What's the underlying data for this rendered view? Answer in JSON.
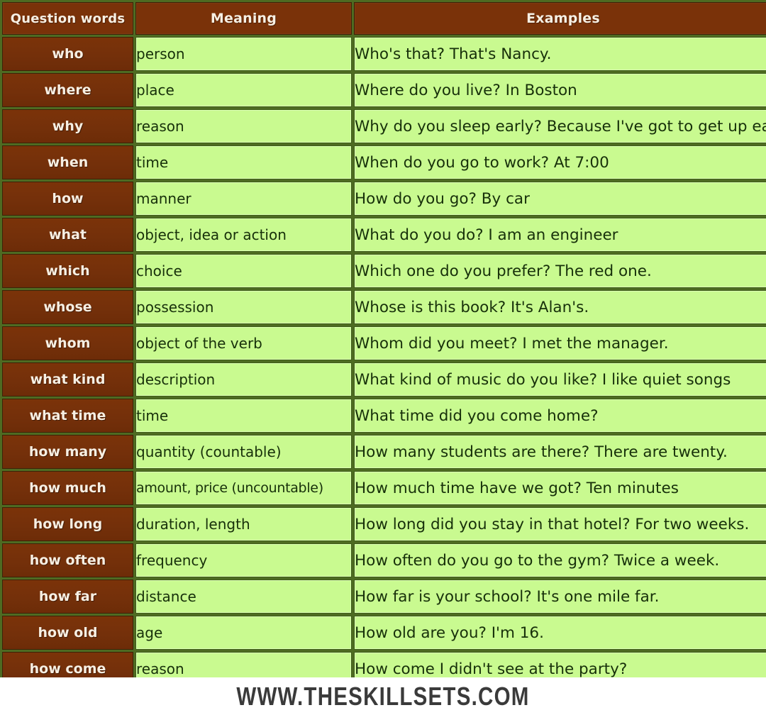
{
  "table": {
    "columns": [
      "Question words",
      "Meaning",
      "Examples"
    ],
    "rows": [
      {
        "word": "who",
        "meaning": "person",
        "example": "Who's that? That's Nancy."
      },
      {
        "word": "where",
        "meaning": "place",
        "example": "Where do you live? In Boston"
      },
      {
        "word": "why",
        "meaning": "reason",
        "example": "Why do you sleep early? Because I've got to get up early"
      },
      {
        "word": "when",
        "meaning": "time",
        "example": "When do you go to work? At 7:00"
      },
      {
        "word": "how",
        "meaning": "manner",
        "example": "How do you go? By car"
      },
      {
        "word": "what",
        "meaning": "object, idea or action",
        "example": "What do you do? I am an engineer"
      },
      {
        "word": "which",
        "meaning": "choice",
        "example": "Which one do you prefer? The red one."
      },
      {
        "word": "whose",
        "meaning": "possession",
        "example": "Whose is this book? It's Alan's."
      },
      {
        "word": "whom",
        "meaning": "object of the verb",
        "example": "Whom did you meet? I met the manager."
      },
      {
        "word": "what kind",
        "meaning": "description",
        "example": "What kind of music do you like? I like quiet songs"
      },
      {
        "word": "what time",
        "meaning": "time",
        "example": "What time did you come home?"
      },
      {
        "word": "how many",
        "meaning": "quantity (countable)",
        "example": "How many students are there? There are twenty."
      },
      {
        "word": "how much",
        "meaning": "amount, price (uncountable)",
        "example": "How much time have we got? Ten minutes"
      },
      {
        "word": "how long",
        "meaning": "duration, length",
        "example": "How long did you stay in that hotel? For two weeks."
      },
      {
        "word": "how often",
        "meaning": "frequency",
        "example": "How often do you go to the gym? Twice a week."
      },
      {
        "word": "how far",
        "meaning": "distance",
        "example": "How far is your school? It's one mile far."
      },
      {
        "word": "how old",
        "meaning": "age",
        "example": "How old are you? I'm 16."
      },
      {
        "word": "how come",
        "meaning": "reason",
        "example": "How come I didn't see at the party?"
      }
    ]
  },
  "watermark": {
    "text": "WWW.THESKILLSETS.COM"
  },
  "footer": {
    "text": "WWW.THESKILLSETS.COM"
  },
  "colors": {
    "header_brown": "#7a3209",
    "cell_green": "#c9fa90",
    "grid_green": "#4e6b22",
    "text_dark": "#17300a",
    "header_text": "#f7efe3",
    "footer_text": "#3a3a3a"
  }
}
